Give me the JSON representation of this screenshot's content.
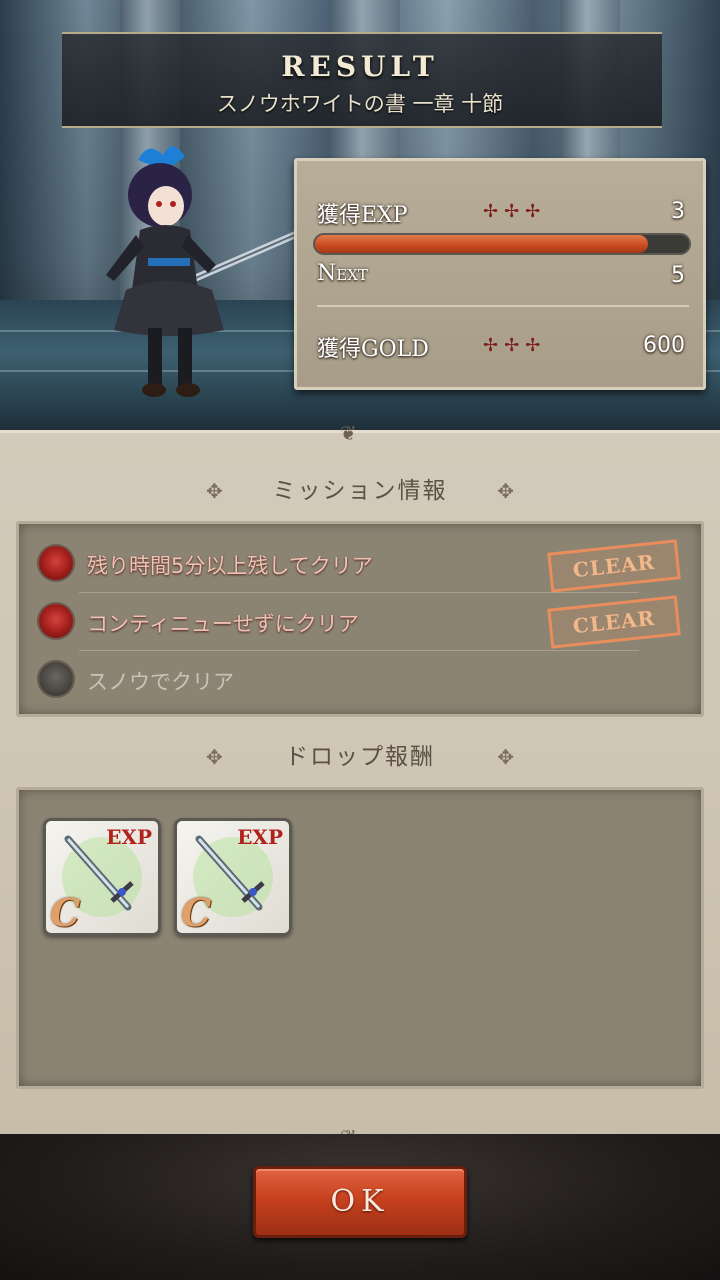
{
  "header": {
    "title": "RESULT",
    "subtitle": "スノウホワイトの書 一章 十節"
  },
  "stats": {
    "exp_label": "獲得EXP",
    "exp_value": "3",
    "exp_progress": 0.89,
    "next_label": "Next",
    "next_value": "5",
    "gold_label": "獲得GOLD",
    "gold_value": "600",
    "cross_glyphs": "✢✢✢"
  },
  "missions": {
    "heading": "ミッション情報",
    "items": [
      {
        "text": "残り時間5分以上残してクリア",
        "status": "CLEAR",
        "cleared": true
      },
      {
        "text": "コンティニューせずにクリア",
        "status": "CLEAR",
        "cleared": true
      },
      {
        "text": "スノウでクリア",
        "status": "",
        "cleared": false
      }
    ]
  },
  "drops": {
    "heading": "ドロップ報酬",
    "items": [
      {
        "tag": "EXP",
        "rarity": "C",
        "icon": "sword-icon"
      },
      {
        "tag": "EXP",
        "rarity": "C",
        "icon": "sword-icon"
      }
    ]
  },
  "ok_label": "OK",
  "colors": {
    "accent": "#c8411f",
    "clear_stamp": "#e88d5b",
    "exp_bar": "#c94a1f"
  }
}
